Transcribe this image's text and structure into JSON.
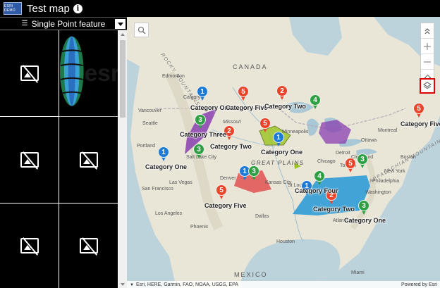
{
  "app": {
    "logo_text": "ESRI DEMO",
    "title": "Test map"
  },
  "panel": {
    "selector_label": "Single Point feature"
  },
  "colors": {
    "blue": "#1f7ad3",
    "green": "#2ea043",
    "orange": "#e8452b",
    "purple": "#8a3fb0",
    "yellowgreen": "#9bc420",
    "red": "#e25050",
    "cyan": "#2596d6"
  },
  "map": {
    "country_labels": [
      "CANADA",
      "MEXICO"
    ],
    "region_labels": [
      "GREAT PLAINS"
    ],
    "range_labels": [
      "ROCKY MOUNTAINS",
      "APPALACHIAN MOUNTAINS"
    ],
    "city_labels": [
      "Edmonton",
      "Calgary",
      "Vancouver",
      "Seattle",
      "Portland",
      "San Francisco",
      "Los Angeles",
      "Phoenix",
      "Dallas",
      "Houston",
      "Denver",
      "Chicago",
      "Toronto",
      "Ottawa",
      "Montreal",
      "New York",
      "Philadelphia",
      "Washington",
      "Boston",
      "Detroit",
      "Atlanta",
      "Miami",
      "Las Vegas",
      "Salt Lake City",
      "Minneapolis",
      "Missouri",
      "St Louis",
      "Kansas City",
      "Cleveland"
    ],
    "attribution": "Esri, HERE, Garmin, FAO, NOAA, USGS, EPA",
    "powered_by": "Powered by Esri",
    "category_labels": [
      "Category One",
      "Category Five",
      "Category Two",
      "Category Three",
      "Category Two",
      "Category One",
      "Category Five",
      "Category One",
      "Category Four",
      "Category Two",
      "Category One",
      "Category Five"
    ],
    "pins": [
      "1",
      "5",
      "2",
      "4",
      "3",
      "2",
      "5",
      "1",
      "1",
      "3",
      "1",
      "3",
      "5",
      "1",
      "4",
      "2",
      "5",
      "3",
      "3"
    ]
  }
}
